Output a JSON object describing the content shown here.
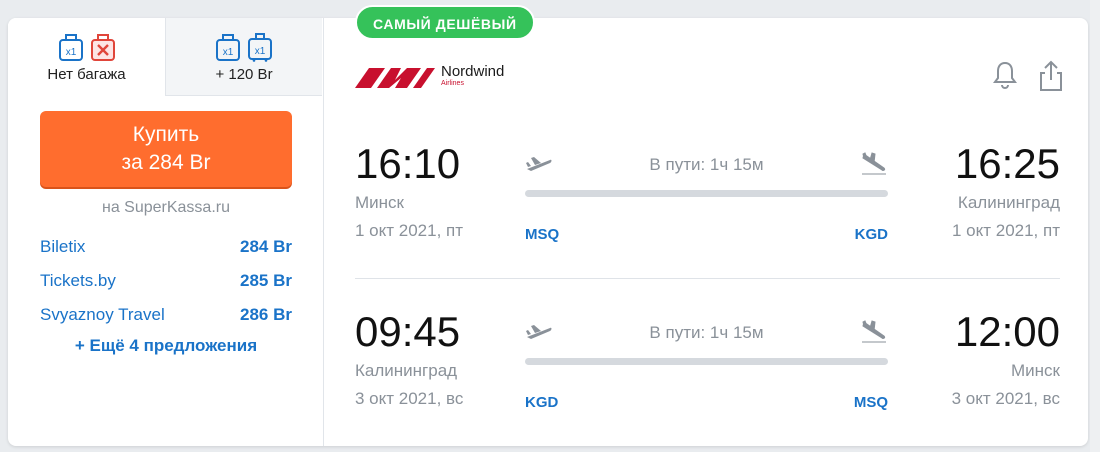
{
  "badge": "САМЫЙ ДЕШЁВЫЙ",
  "baggage_tabs": [
    {
      "label": "Нет багажа",
      "icons": [
        {
          "type": "hand-bag-icon",
          "text": "x1"
        },
        {
          "type": "no-baggage-icon",
          "text": ""
        }
      ]
    },
    {
      "label": "+ 120 Br",
      "icons": [
        {
          "type": "hand-bag-icon",
          "text": "x1"
        },
        {
          "type": "suitcase-icon",
          "text": "x1"
        }
      ]
    }
  ],
  "buy": {
    "line1": "Купить",
    "line2": "за 284 Br"
  },
  "seller": "на SuperKassa.ru",
  "offers": [
    {
      "name": "Biletix",
      "price": "284 Br"
    },
    {
      "name": "Tickets.by",
      "price": "285 Br"
    },
    {
      "name": "Svyaznoy Travel",
      "price": "286 Br"
    }
  ],
  "more_offers": "+ Ещё 4 предложения",
  "airline": {
    "name": "Nordwind",
    "sub": "Airlines"
  },
  "segments": [
    {
      "dep_time": "16:10",
      "dep_city": "Минск",
      "dep_date": "1 окт 2021, пт",
      "dep_iata": "MSQ",
      "arr_time": "16:25",
      "arr_city": "Калининград",
      "arr_date": "1 окт 2021, пт",
      "arr_iata": "KGD",
      "duration": "В пути: 1ч 15м"
    },
    {
      "dep_time": "09:45",
      "dep_city": "Калининград",
      "dep_date": "3 окт 2021, вс",
      "dep_iata": "KGD",
      "arr_time": "12:00",
      "arr_city": "Минск",
      "arr_date": "3 окт 2021, вс",
      "arr_iata": "MSQ",
      "duration": "В пути: 1ч 15м"
    }
  ],
  "colors": {
    "accent": "#ff6d2e",
    "link": "#1a73c8",
    "badge": "#35c25a",
    "airline_red": "#c8102e"
  }
}
